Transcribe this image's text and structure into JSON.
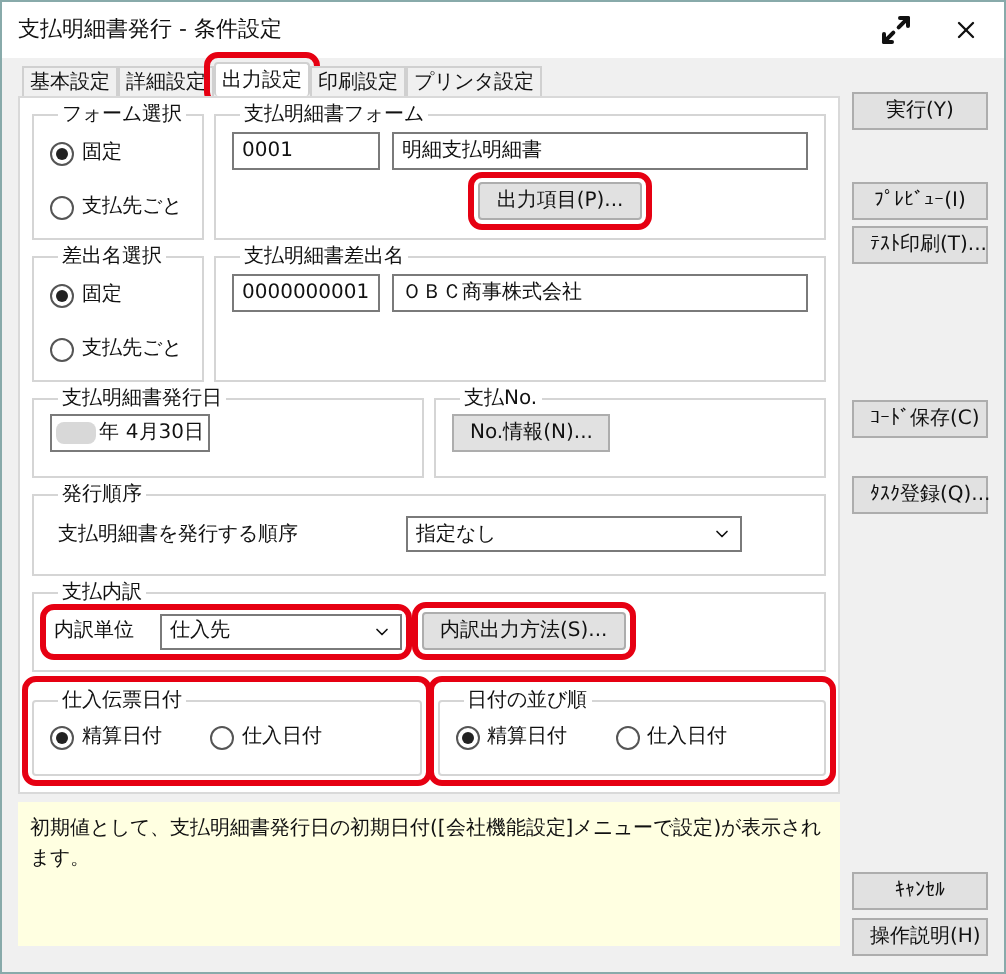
{
  "window": {
    "title": "支払明細書発行 - 条件設定"
  },
  "tabs": [
    {
      "label": "基本設定",
      "selected": false,
      "highlighted": false
    },
    {
      "label": "詳細設定",
      "selected": false,
      "highlighted": false
    },
    {
      "label": "出力設定",
      "selected": true,
      "highlighted": true
    },
    {
      "label": "印刷設定",
      "selected": false,
      "highlighted": false
    },
    {
      "label": "プリンタ設定",
      "selected": false,
      "highlighted": false
    }
  ],
  "form_select": {
    "title": "フォーム選択",
    "options": [
      {
        "label": "固定",
        "selected": true
      },
      {
        "label": "支払先ごと",
        "selected": false
      }
    ]
  },
  "form": {
    "title": "支払明細書フォーム",
    "code": "0001",
    "name": "明細支払明細書",
    "button": {
      "label": "出力項目(P)...",
      "highlighted": true
    }
  },
  "sender_select": {
    "title": "差出名選択",
    "options": [
      {
        "label": "固定",
        "selected": true
      },
      {
        "label": "支払先ごと",
        "selected": false
      }
    ]
  },
  "sender": {
    "title": "支払明細書差出名",
    "code": "0000000001",
    "name": "ＯＢＣ商事株式会社"
  },
  "issue_date": {
    "title": "支払明細書発行日",
    "value": "年 4月30日"
  },
  "payment_no": {
    "title": "支払No.",
    "button": {
      "label": "No.情報(N)...",
      "highlighted": false
    }
  },
  "issue_order": {
    "title": "発行順序",
    "label": "支払明細書を発行する順序",
    "value": "指定なし"
  },
  "breakdown": {
    "title": "支払内訳",
    "unit": {
      "label": "内訳単位",
      "value": "仕入先",
      "highlighted": true
    },
    "button": {
      "label": "内訳出力方法(S)...",
      "highlighted": true
    }
  },
  "voucher_date": {
    "title": "仕入伝票日付",
    "highlighted": true,
    "options": [
      {
        "label": "精算日付",
        "selected": true
      },
      {
        "label": "仕入日付",
        "selected": false
      }
    ]
  },
  "date_order": {
    "title": "日付の並び順",
    "highlighted": true,
    "options": [
      {
        "label": "精算日付",
        "selected": true
      },
      {
        "label": "仕入日付",
        "selected": false
      }
    ]
  },
  "help_text": "初期値として、支払明細書発行日の初期日付([会社機能設定]メニューで設定)が表示されます。",
  "side_button_groups": [
    [
      {
        "label": "実行(Y)"
      }
    ],
    [
      {
        "label": "ﾌﾟﾚﾋﾞｭｰ(I)"
      },
      {
        "label": "ﾃｽﾄ印刷(T)..."
      }
    ],
    [
      {
        "label": "ｺｰﾄﾞ保存(C)"
      }
    ],
    [
      {
        "label": "ﾀｽｸ登録(Q)..."
      }
    ]
  ],
  "bottom_buttons": [
    {
      "label": "ｷｬﾝｾﾙ"
    },
    {
      "label": "操作説明(H)"
    }
  ]
}
